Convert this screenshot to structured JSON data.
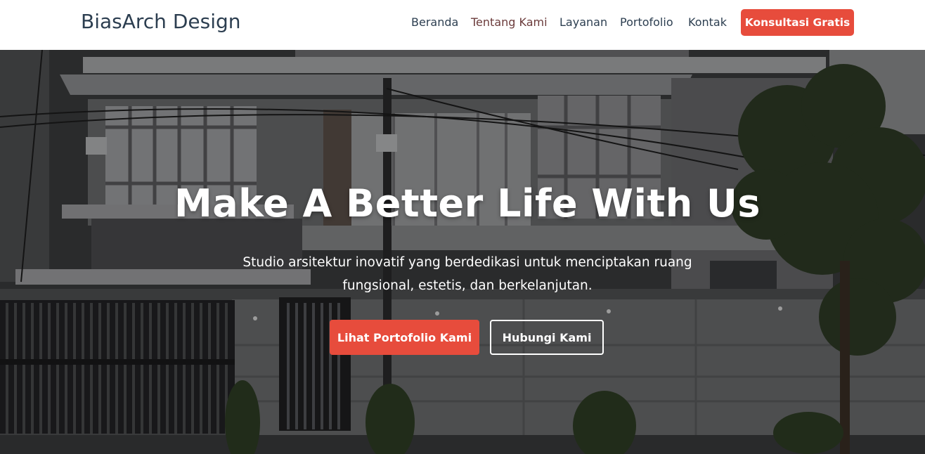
{
  "navbar": {
    "brand": "BiasArch Design",
    "links": [
      {
        "label": "Beranda",
        "active": false
      },
      {
        "label": "Tentang Kami",
        "active": true
      },
      {
        "label": "Layanan",
        "active": false
      },
      {
        "label": "Portofolio",
        "active": false
      },
      {
        "label": "Kontak",
        "active": false
      }
    ],
    "cta_label": "Konsultasi Gratis"
  },
  "hero": {
    "title": "Make A Better Life With Us",
    "subtitle": "Studio arsitektur inovatif yang berdedikasi untuk menciptakan ruang fungsional, estetis, dan berkelanjutan.",
    "primary_button": "Lihat Portofolio Kami",
    "secondary_button": "Hubungi Kami"
  },
  "colors": {
    "accent": "#e74c3c",
    "brand_text": "#2c3e50",
    "active_link": "#6b3b3b"
  }
}
